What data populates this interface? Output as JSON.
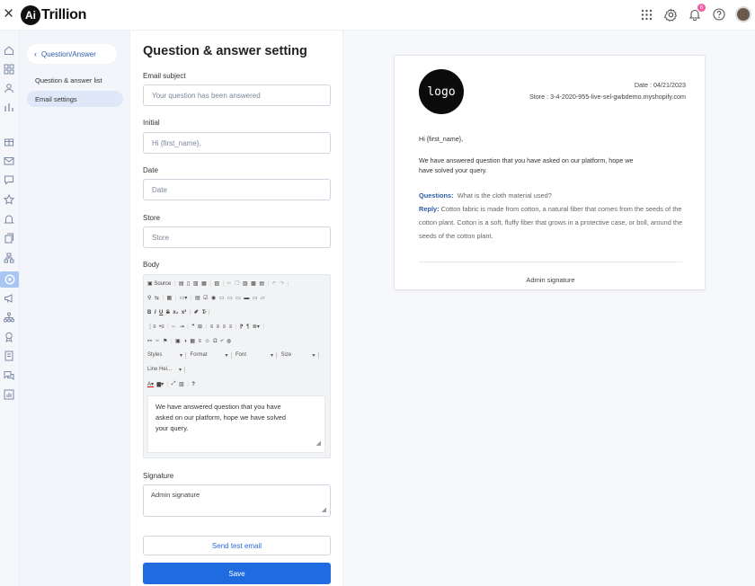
{
  "app": {
    "logo_mark": "Ai",
    "logo_text": "Trillion",
    "notification_count": "6"
  },
  "subnav": {
    "back_label": "Question/Answer",
    "items": [
      {
        "label": "Question & answer list"
      },
      {
        "label": "Email settings"
      }
    ]
  },
  "form": {
    "title": "Question & answer setting",
    "email_subject": {
      "label": "Email subject",
      "placeholder": "Your question has been answered"
    },
    "initial": {
      "label": "Initial",
      "placeholder": "Hi {first_name},"
    },
    "date": {
      "label": "Date",
      "placeholder": "Date"
    },
    "store": {
      "label": "Store",
      "placeholder": "Store"
    },
    "body": {
      "label": "Body",
      "toolbar": {
        "source": "Source",
        "styles": "Styles",
        "format": "Format",
        "font": "Font",
        "size": "Size",
        "line_height": "Line Hei..."
      },
      "text": "We have answered question that you have asked on our platform, hope we have solved your query."
    },
    "signature": {
      "label": "Signature",
      "value": "Admin signature"
    },
    "send_test_label": "Send test email",
    "save_label": "Save"
  },
  "preview": {
    "logo_text": "logo",
    "date": "Date : 04/21/2023",
    "store": "Store : 3-4-2020-955-live-sel-gwbdemo.myshopify.com",
    "greeting": "Hi {first_name},",
    "body_line1": "We have answered question that you have asked on our platform, hope we",
    "body_line2": "have solved your query.",
    "question_label": "Questions:",
    "question_text": "What is the cloth material used?",
    "reply_label": "Reply:",
    "reply_text": "Cotton fabric is made from cotton, a natural fiber that comes from the seeds of the cotton plant. Cotton is a soft, fluffy fiber that grows in a protective case, or boll, around the seeds of the cotton plant.",
    "signature": "Admin signature"
  },
  "colors": {
    "accent": "#1f6ce0",
    "link": "#2f5ea8",
    "rail_active": "#a9c6f3"
  }
}
